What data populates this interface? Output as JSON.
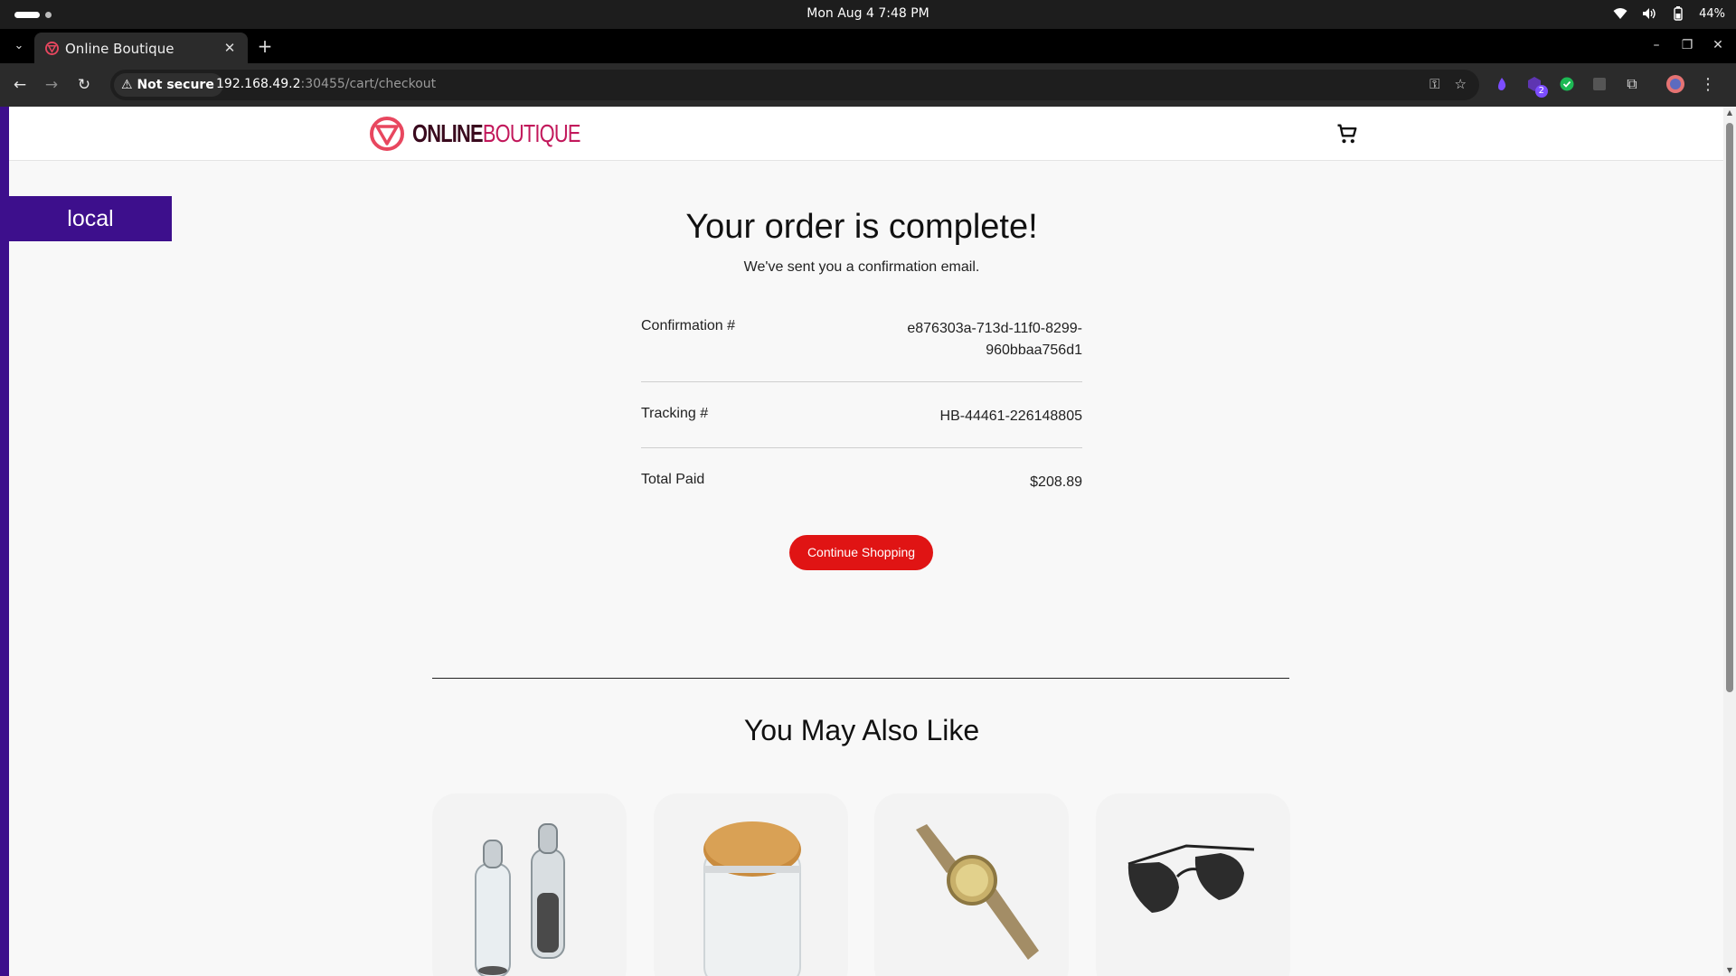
{
  "os_bar": {
    "datetime": "Mon Aug 4   7:48 PM",
    "battery": "44%"
  },
  "browser": {
    "tab_title": "Online Boutique",
    "security_label": "Not secure",
    "url_host": "192.168.49.2",
    "url_rest": ":30455/cart/checkout",
    "extension_badge": "2"
  },
  "site": {
    "logo_bold": "ONLINE",
    "logo_light": "BOUTIQUE",
    "env_label": "local"
  },
  "order": {
    "title": "Your order is complete!",
    "subtitle": "We've sent you a confirmation email.",
    "confirmation_label": "Confirmation #",
    "confirmation_line1": "e876303a-713d-11f0-8299-",
    "confirmation_line2": "960bbaa756d1",
    "tracking_label": "Tracking #",
    "tracking_value": "HB-44461-226148805",
    "total_label": "Total Paid",
    "total_value": "$208.89",
    "continue_label": "Continue Shopping"
  },
  "recommendations": {
    "title": "You May Also Like",
    "items": [
      {
        "name": "salt-pepper-shakers"
      },
      {
        "name": "mason-jar"
      },
      {
        "name": "wristwatch"
      },
      {
        "name": "sunglasses"
      }
    ]
  },
  "colors": {
    "accent": "#e01414",
    "env_bar": "#3d0f8c",
    "logo_dark": "#3a0a1e",
    "logo_pink": "#c2185b"
  }
}
